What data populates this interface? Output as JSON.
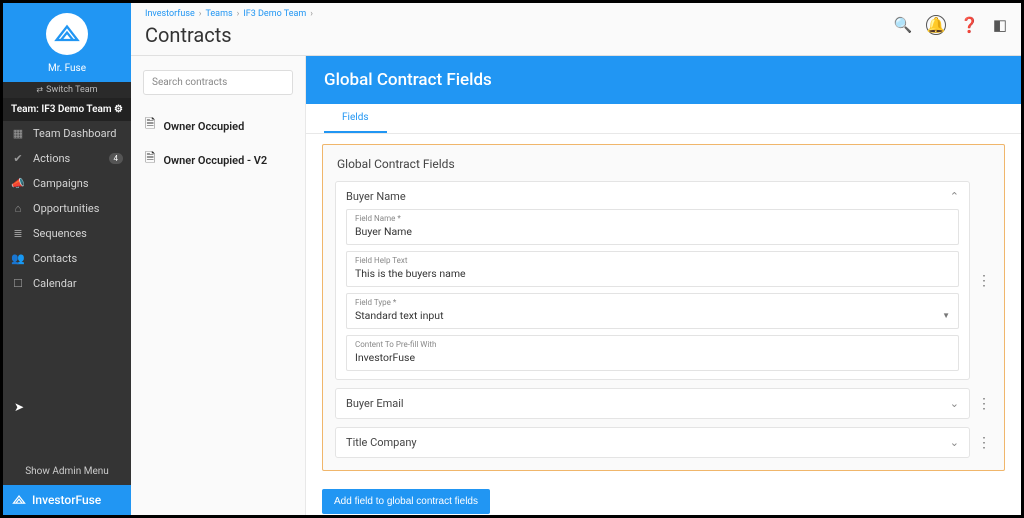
{
  "sidebar": {
    "user": "Mr. Fuse",
    "switch": "Switch Team",
    "team_label": "Team: IF3 Demo Team",
    "items": [
      {
        "icon": "▦",
        "label": "Team Dashboard"
      },
      {
        "icon": "✔",
        "label": "Actions",
        "badge": "4"
      },
      {
        "icon": "📣",
        "label": "Campaigns"
      },
      {
        "icon": "⌂",
        "label": "Opportunities"
      },
      {
        "icon": "≣",
        "label": "Sequences"
      },
      {
        "icon": "👥",
        "label": "Contacts"
      },
      {
        "icon": "☐",
        "label": "Calendar"
      }
    ],
    "admin": "Show Admin Menu",
    "footer": "InvestorFuse"
  },
  "breadcrumbs": [
    "Investorfuse",
    "Teams",
    "IF3 Demo Team"
  ],
  "page_title": "Contracts",
  "search_placeholder": "Search contracts",
  "contracts": [
    {
      "label": "Owner Occupied"
    },
    {
      "label": "Owner Occupied - V2"
    }
  ],
  "banner": "Global Contract Fields",
  "tab": "Fields",
  "panel_title": "Global Contract Fields",
  "expanded": {
    "title": "Buyer Name",
    "fields": [
      {
        "label": "Field Name *",
        "value": "Buyer Name",
        "type": "text"
      },
      {
        "label": "Field Help Text",
        "value": "This is the buyers name",
        "type": "text"
      },
      {
        "label": "Field Type *",
        "value": "Standard text input",
        "type": "select"
      },
      {
        "label": "Content To Pre-fill With",
        "value": "InvestorFuse",
        "type": "text"
      }
    ]
  },
  "collapsed": [
    "Buyer Email",
    "Title Company"
  ],
  "add_button": "Add field to global contract fields"
}
